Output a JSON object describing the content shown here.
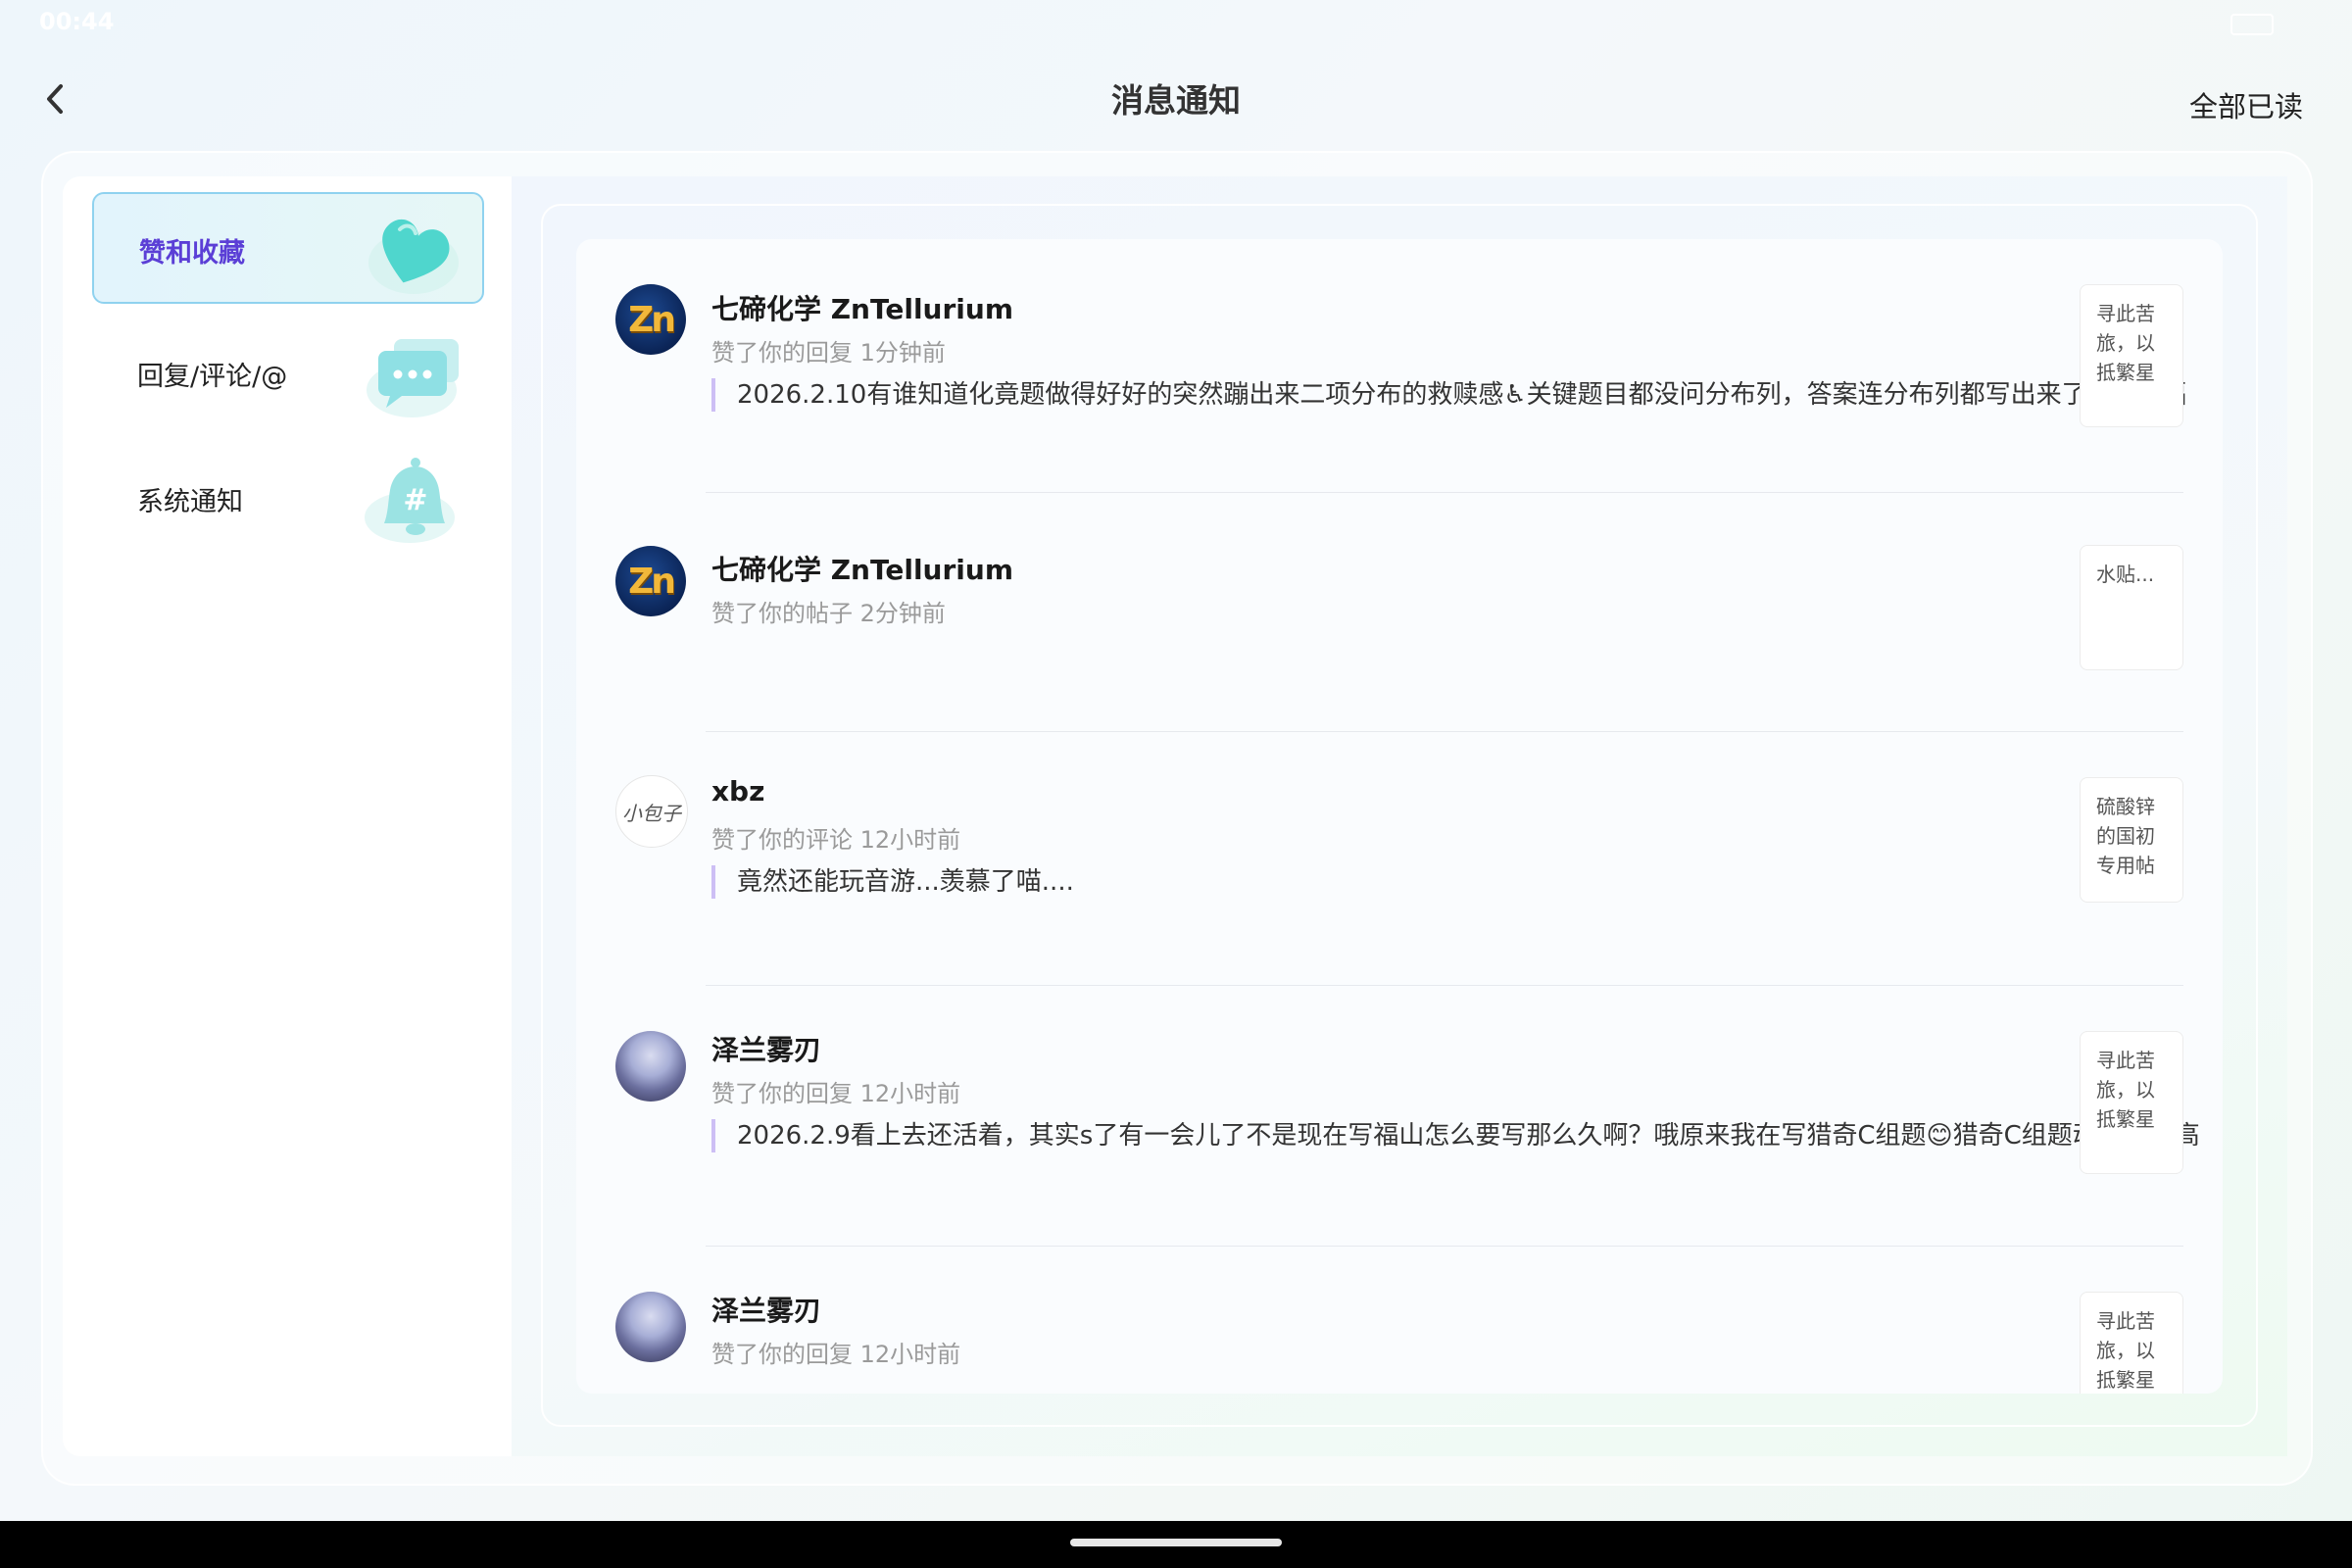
{
  "status": {
    "time": "00:44"
  },
  "header": {
    "title": "消息通知",
    "mark_all_read": "全部已读"
  },
  "sidebar": {
    "items": [
      {
        "label": "赞和收藏",
        "icon": "heart-icon",
        "active": true
      },
      {
        "label": "回复/评论/@",
        "icon": "chat-bubble-icon",
        "active": false
      },
      {
        "label": "系统通知",
        "icon": "bell-icon",
        "active": false
      }
    ]
  },
  "notifications": [
    {
      "user": "七碲化学 ZnTellurium",
      "avatar_text": "Zn",
      "action": "赞了你的回复",
      "time": "1分钟前",
      "quote": "2026.2.10有谁知道化竟题做得好好的突然蹦出来二项分布的救赎感♿关键题目都没问分布列，答案连分布列都写出来了♿我很福",
      "thumb": "寻此苦旅，以抵繁星"
    },
    {
      "user": "七碲化学 ZnTellurium",
      "avatar_text": "Zn",
      "action": "赞了你的帖子",
      "time": "2分钟前",
      "quote": "",
      "thumb": "水贴..."
    },
    {
      "user": "xbz",
      "avatar_text": "小包子",
      "action": "赞了你的评论",
      "time": "12小时前",
      "quote": "竟然还能玩音游...羡慕了喵....",
      "thumb": "硫酸锌的国初专用帖"
    },
    {
      "user": "泽兰雾刃",
      "avatar_text": "",
      "action": "赞了你的回复",
      "time": "12小时前",
      "quote": "2026.2.9看上去还活着，其实s了有一会儿了不是现在写福山怎么要写那么久啊？哦原来我在写猎奇C组题😊猎奇C组题动不动玩高",
      "thumb": "寻此苦旅，以抵繁星"
    },
    {
      "user": "泽兰雾刃",
      "avatar_text": "",
      "action": "赞了你的回复",
      "time": "12小时前",
      "quote": "",
      "thumb": "寻此苦旅，以抵繁星"
    }
  ]
}
